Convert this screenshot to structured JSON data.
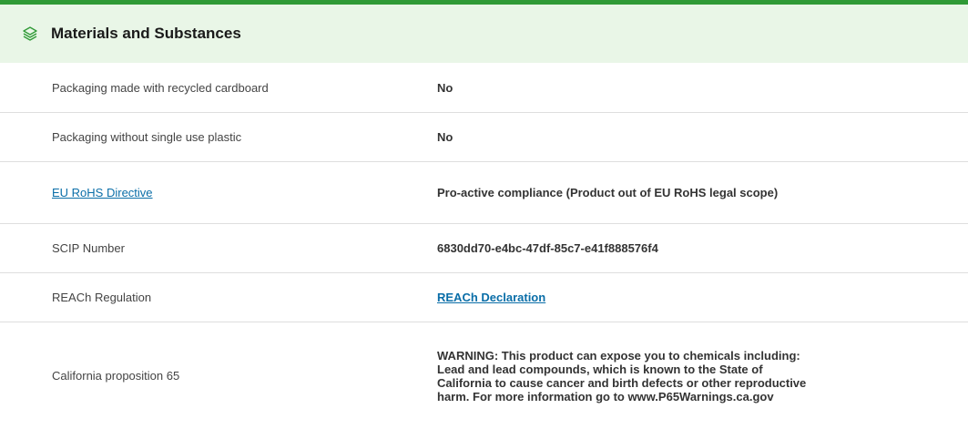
{
  "section": {
    "title": "Materials and Substances",
    "icon": "layers-icon",
    "accent_color": "#2f9a36",
    "header_bg": "#e9f6e7",
    "link_color": "#0a6ea8"
  },
  "rows": [
    {
      "label": "Packaging made with recycled cardboard",
      "value": "No"
    },
    {
      "label": "Packaging without single use plastic",
      "value": "No"
    },
    {
      "label": "EU RoHS Directive",
      "value": "Pro-active compliance (Product out of EU RoHS legal scope)"
    },
    {
      "label": "SCIP Number",
      "value": "6830dd70-e4bc-47df-85c7-e41f888576f4"
    },
    {
      "label": "REACh Regulation",
      "value": "REACh Declaration"
    },
    {
      "label": "California proposition 65",
      "value": "WARNING: This product can expose you to chemicals including: Lead and lead compounds, which is known to the State of California to cause cancer and birth defects or other reproductive harm. For more information go to www.P65Warnings.ca.gov"
    }
  ]
}
